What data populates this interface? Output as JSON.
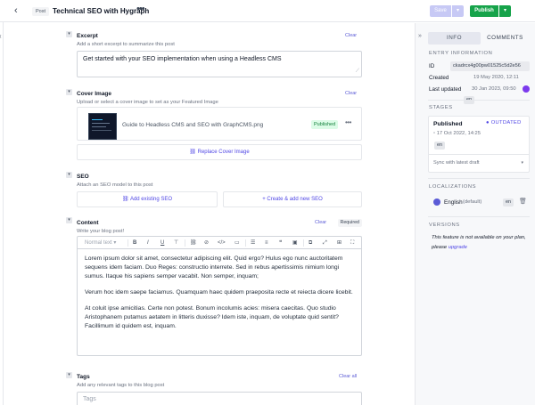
{
  "header": {
    "back_icon": "chevron-left-icon",
    "model_badge": "Post",
    "entry_title": "Technical SEO with Hygraph",
    "more_label": "•••",
    "save_label": "Save",
    "publish_label": "Publish",
    "dropdown_glyph": "▾"
  },
  "fields": {
    "excerpt": {
      "title": "Excerpt",
      "description": "Add a short excerpt to summarize this post",
      "action": "Clear",
      "value": "Get started with your SEO implementation when using a Headless CMS"
    },
    "cover_image": {
      "title": "Cover Image",
      "description": "Upload or select a cover image to set as your Featured Image",
      "action": "Clear",
      "asset_name": "Guide to Headless CMS and SEO with GraphCMS.png",
      "asset_status": "Published",
      "replace_label": "Replace Cover Image"
    },
    "seo": {
      "title": "SEO",
      "description": "Attach an SEO model to this post",
      "add_existing_label": "Add existing SEO",
      "create_label": "Create & add new SEO"
    },
    "content": {
      "title": "Content",
      "description": "Write your blog post!",
      "action": "Clear",
      "required_badge": "Required",
      "toolbar_style": "Normal text",
      "paragraphs": [
        "Lorem ipsum dolor sit amet, consectetur adipiscing elit. Quid ergo? Hulus ego nunc auctoritatem sequens idem faciam. Duo Reges: constructio interrete. Sed in rebus apertissimis nimium longi sumus. Itaque his sapiens semper vacabit. Non semper, inquam;",
        "Verum hoc idem saepe faciamus. Quamquam haec quidem praeposita recte et reiecta dicere licebit.",
        "At coluit ipse amicitias. Certe non potest. Bonum incolumis acies: misera caecitas. Quo studio Aristophanem putamus aetatem in litteris duxisse? Idem iste, inquam, de voluptate quid sentit? Facillimum id quidem est, inquam."
      ]
    },
    "tags": {
      "title": "Tags",
      "description": "Add any relevant tags to this blog post",
      "action": "Clear all",
      "placeholder": "Tags"
    }
  },
  "sidebar": {
    "tabs": [
      "INFO",
      "COMMENTS"
    ],
    "entry_info": {
      "section_title": "ENTRY INFORMATION",
      "id_label": "ID",
      "id_value": "ckadrcx4g00pw01525c5d2e56",
      "created_label": "Created",
      "created_value": "19 May 2020, 12:11",
      "created_locale": "en",
      "updated_label": "Last updated",
      "updated_value": "30 Jan 2023, 09:50"
    },
    "stages": {
      "section_title": "STAGES",
      "stage_name": "Published",
      "stage_status": "OUTDATED",
      "stage_date": "17 Oct 2022, 14:25",
      "stage_locale": "en",
      "sync_label": "Sync with latest draft"
    },
    "localizations": {
      "section_title": "LOCALIZATIONS",
      "language": "English",
      "default_label": "(default)",
      "locale_code": "en"
    },
    "versions": {
      "section_title": "VERSIONS",
      "note": "This feature is not available on your plan, please",
      "link": "upgrade"
    }
  }
}
